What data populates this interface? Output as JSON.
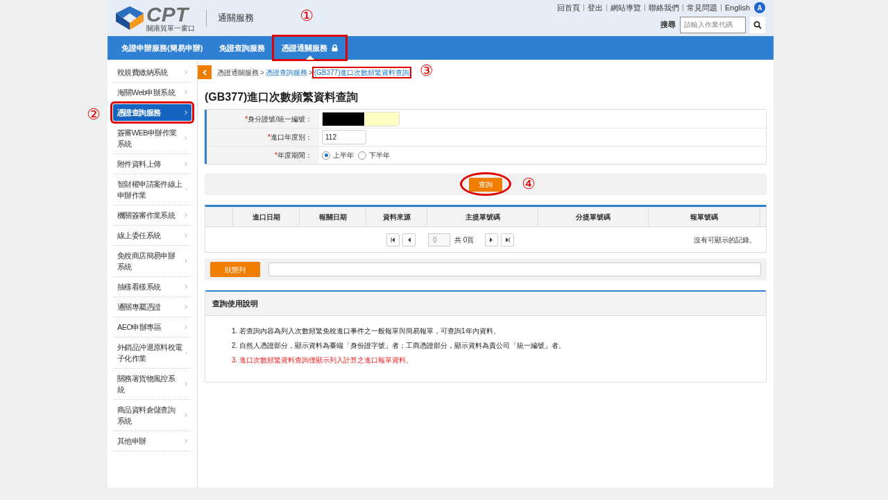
{
  "header": {
    "logo_text": "CPT",
    "logo_subtitle": "關港貿單一窗口",
    "site_name": "通關服務",
    "top_links": [
      "回首頁",
      "登出",
      "網站導覽",
      "聯絡我們",
      "常見問題",
      "English"
    ],
    "avatar_letter": "A",
    "search_label": "搜尋",
    "search_placeholder": "請輸入作業代碼"
  },
  "nav_tabs": [
    {
      "label": "免證申辦服務(簡易申辦)",
      "selected": false,
      "locked": false
    },
    {
      "label": "免證查詢服務",
      "selected": false,
      "locked": false
    },
    {
      "label": "憑證通關服務",
      "selected": true,
      "locked": true,
      "annotation": "①"
    }
  ],
  "sidebar": {
    "items": [
      {
        "label": "稅規費繳納系統",
        "selected": false
      },
      {
        "label": "海關Web申辦系統",
        "selected": false
      },
      {
        "label": "憑證查詢服務",
        "selected": true,
        "annotation": "②"
      },
      {
        "label": "簽審WEB申辦作業系統",
        "selected": false
      },
      {
        "label": "附件資料上傳",
        "selected": false
      },
      {
        "label": "智財權申請案件線上申辦作業",
        "selected": false
      },
      {
        "label": "機關簽審作業系統",
        "selected": false
      },
      {
        "label": "線上委任系統",
        "selected": false
      },
      {
        "label": "免稅商店簡易申辦系統",
        "selected": false
      },
      {
        "label": "抽樣看樣系統",
        "selected": false
      },
      {
        "label": "通關專屬憑證",
        "selected": false
      },
      {
        "label": "AEO申辦專區",
        "selected": false
      },
      {
        "label": "外銷品沖退原料稅電子化作業",
        "selected": false
      },
      {
        "label": "關務署貨物風控系統",
        "selected": false
      },
      {
        "label": "商品資料倉儲查詢系統",
        "selected": false
      },
      {
        "label": "其他申辦",
        "selected": false
      }
    ]
  },
  "breadcrumb": [
    {
      "label": "憑證通關服務",
      "kind": "text"
    },
    {
      "label": ">",
      "kind": "separator"
    },
    {
      "label": "憑證查詢服務",
      "kind": "link"
    },
    {
      "label": ">",
      "kind": "separator"
    },
    {
      "label": "(GB377)進口次數頻繁資料查詢",
      "kind": "current",
      "annotation": "③"
    }
  ],
  "page_title": "(GB377)進口次數頻繁資料查詢",
  "form": [
    {
      "kind": "text",
      "label": "身分證號/統一編號：",
      "required_mark": "*",
      "redacted": true
    },
    {
      "kind": "text",
      "label": "進口年度別：",
      "required_mark": "*",
      "value": "112"
    },
    {
      "kind": "radio",
      "label": "年度期間：",
      "required_mark": "*",
      "options": [
        {
          "label": "上半年",
          "selected": true
        },
        {
          "label": "下半年",
          "selected": false
        }
      ]
    }
  ],
  "query_button": {
    "label": "查詢",
    "annotation": "④"
  },
  "table": {
    "columns": [
      "進口日期",
      "報關日期",
      "資料來源",
      "主提單號碼",
      "分提單號碼",
      "報單號碼"
    ],
    "page_value": "0",
    "page_total": "共 0頁",
    "empty_message": "沒有可顯示的記錄。"
  },
  "status_button": "狀態列",
  "instructions": {
    "title": "查詢使用說明",
    "items": [
      {
        "text": "1. 若查詢內容為列入次數頻繁免稅進口事件之一般報單與簡易報單，可查詢1年內資料。",
        "warning": false
      },
      {
        "text": "2. 自然人憑證部分，顯示資料為臺端「身份證字號」者；工商憑證部分，顯示資料為貴公司「統一編號」者。",
        "warning": false
      },
      {
        "text": "3. 進口次數頻繁資料查詢僅顯示列入計算之進口報單資料。",
        "warning": true
      }
    ]
  }
}
